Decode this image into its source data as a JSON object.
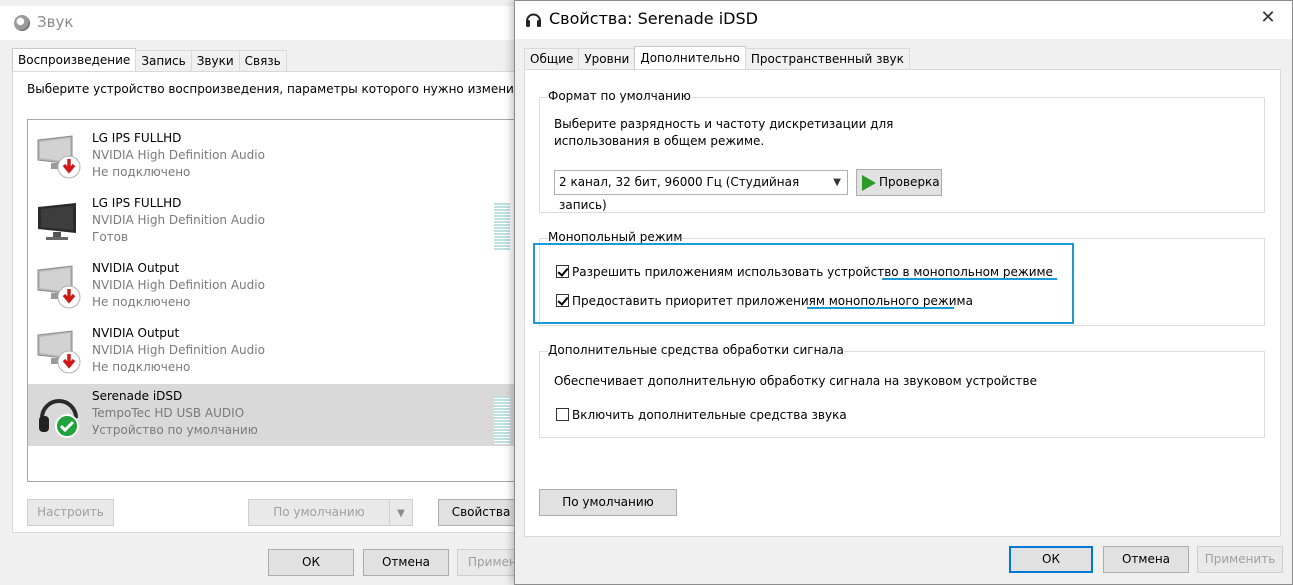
{
  "back_window": {
    "title": "Звук",
    "tabs": [
      {
        "label": "Воспроизведение",
        "active": true
      },
      {
        "label": "Запись",
        "active": false
      },
      {
        "label": "Звуки",
        "active": false
      },
      {
        "label": "Связь",
        "active": false
      }
    ],
    "prompt": "Выберите устройство воспроизведения, параметры которого нужно изменить:",
    "devices": [
      {
        "name": "LG IPS FULLHD",
        "driver": "NVIDIA High Definition Audio",
        "status": "Не подключено",
        "icon": "monitor-disconnected-icon"
      },
      {
        "name": "LG IPS FULLHD",
        "driver": "NVIDIA High Definition Audio",
        "status": "Готов",
        "icon": "monitor-icon"
      },
      {
        "name": "NVIDIA Output",
        "driver": "NVIDIA High Definition Audio",
        "status": "Не подключено",
        "icon": "monitor-disconnected-icon"
      },
      {
        "name": "NVIDIA Output",
        "driver": "NVIDIA High Definition Audio",
        "status": "Не подключено",
        "icon": "monitor-disconnected-icon"
      },
      {
        "name": "Serenade iDSD",
        "driver": "TempoTec HD USB AUDIO",
        "status": "Устройство по умолчанию",
        "icon": "headphones-default-icon"
      }
    ],
    "buttons": {
      "configure": "Настроить",
      "set_default": "По умолчанию",
      "properties": "Свойства",
      "ok": "ОК",
      "cancel": "Отмена",
      "apply": "Примени"
    }
  },
  "front_window": {
    "title": "Свойства: Serenade iDSD",
    "close": "✕",
    "tabs": [
      {
        "label": "Общие",
        "active": false
      },
      {
        "label": "Уровни",
        "active": false
      },
      {
        "label": "Дополнительно",
        "active": true
      },
      {
        "label": "Пространственный звук",
        "active": false
      }
    ],
    "default_format": {
      "legend": "Формат по умолчанию",
      "description_line1": "Выберите разрядность и частоту дискретизации для",
      "description_line2": "использования в общем режиме.",
      "selected_format": "2 канал, 32 бит, 96000 Гц (Студийная запись)",
      "test_button": "Проверка"
    },
    "exclusive_mode": {
      "legend": "Монопольный режим",
      "allow_exclusive": {
        "label": "Разрешить приложениям использовать устройство в монопольном режиме",
        "checked": true
      },
      "give_priority": {
        "label": "Предоставить приоритет приложениям монопольного режима",
        "checked": true
      }
    },
    "signal_enhancements": {
      "legend": "Дополнительные средства обработки сигнала",
      "description": "Обеспечивает дополнительную обработку сигнала на звуковом устройстве",
      "enable_enhancements": {
        "label": "Включить дополнительные средства звука",
        "checked": false
      }
    },
    "buttons": {
      "restore_defaults": "По умолчанию",
      "ok": "ОК",
      "cancel": "Отмена",
      "apply": "Применить"
    }
  },
  "colors": {
    "highlight": "#1a9ad6",
    "accent": "#0078d7",
    "check_green": "#1fa33a",
    "disconnect_red": "#d01818"
  }
}
